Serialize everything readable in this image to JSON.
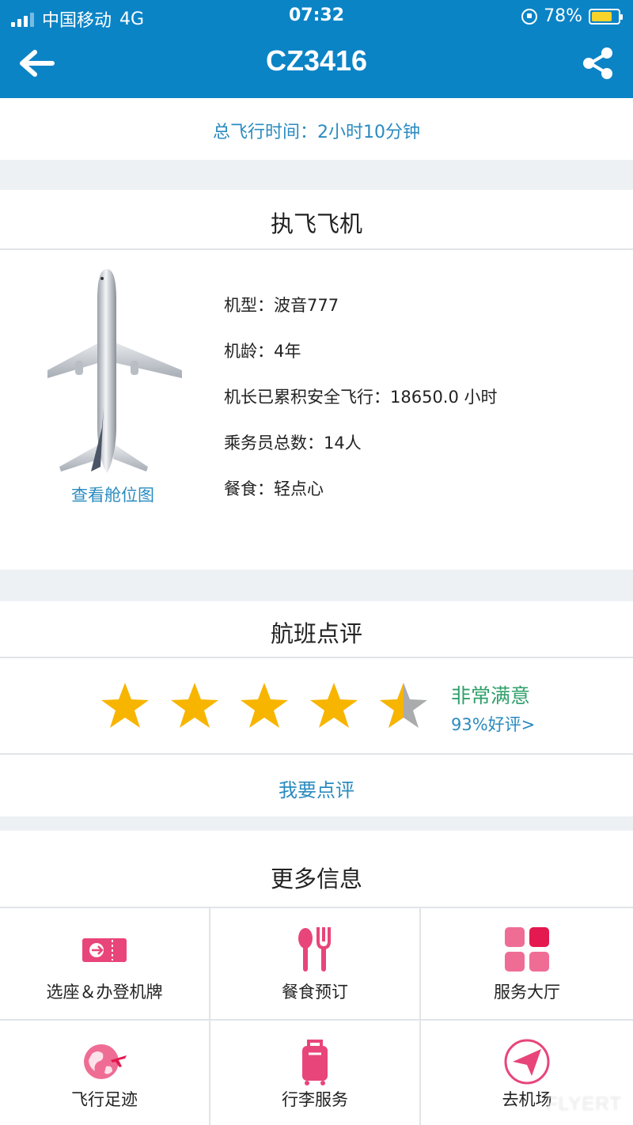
{
  "status_bar": {
    "carrier": "中国移动",
    "network": "4G",
    "time": "07:32",
    "battery": "78%"
  },
  "nav": {
    "title": "CZ3416"
  },
  "flight": {
    "duration": "总飞行时间：2小时10分钟"
  },
  "aircraft": {
    "title": "执飞飞机",
    "seat_map": "查看舱位图",
    "info": [
      "机型：波音777",
      "机龄：4年",
      "机长已累积安全飞行：18650.0 小时",
      "乘务员总数：14人",
      "餐食：轻点心"
    ]
  },
  "review": {
    "title": "航班点评",
    "rating": 4.5,
    "rating_max": 5,
    "satisfaction": "非常满意",
    "positive_rate": "93%好评>",
    "write": "我要点评"
  },
  "more": {
    "title": "更多信息",
    "items": [
      {
        "label": "选座＆办登机牌",
        "icon": "boarding-pass-icon"
      },
      {
        "label": "餐食预订",
        "icon": "fork-spoon-icon"
      },
      {
        "label": "服务大厅",
        "icon": "grid-icon"
      },
      {
        "label": "飞行足迹",
        "icon": "globe-plane-icon"
      },
      {
        "label": "行李服务",
        "icon": "luggage-icon"
      },
      {
        "label": "去机场",
        "icon": "navigation-arrow-icon"
      }
    ]
  },
  "colors": {
    "primary": "#0b84c6",
    "accent_pink": "#e8457a",
    "star": "#f7b500",
    "link": "#2a8bc0",
    "satisfied": "#2fa06a"
  },
  "watermark": "FLYERT"
}
